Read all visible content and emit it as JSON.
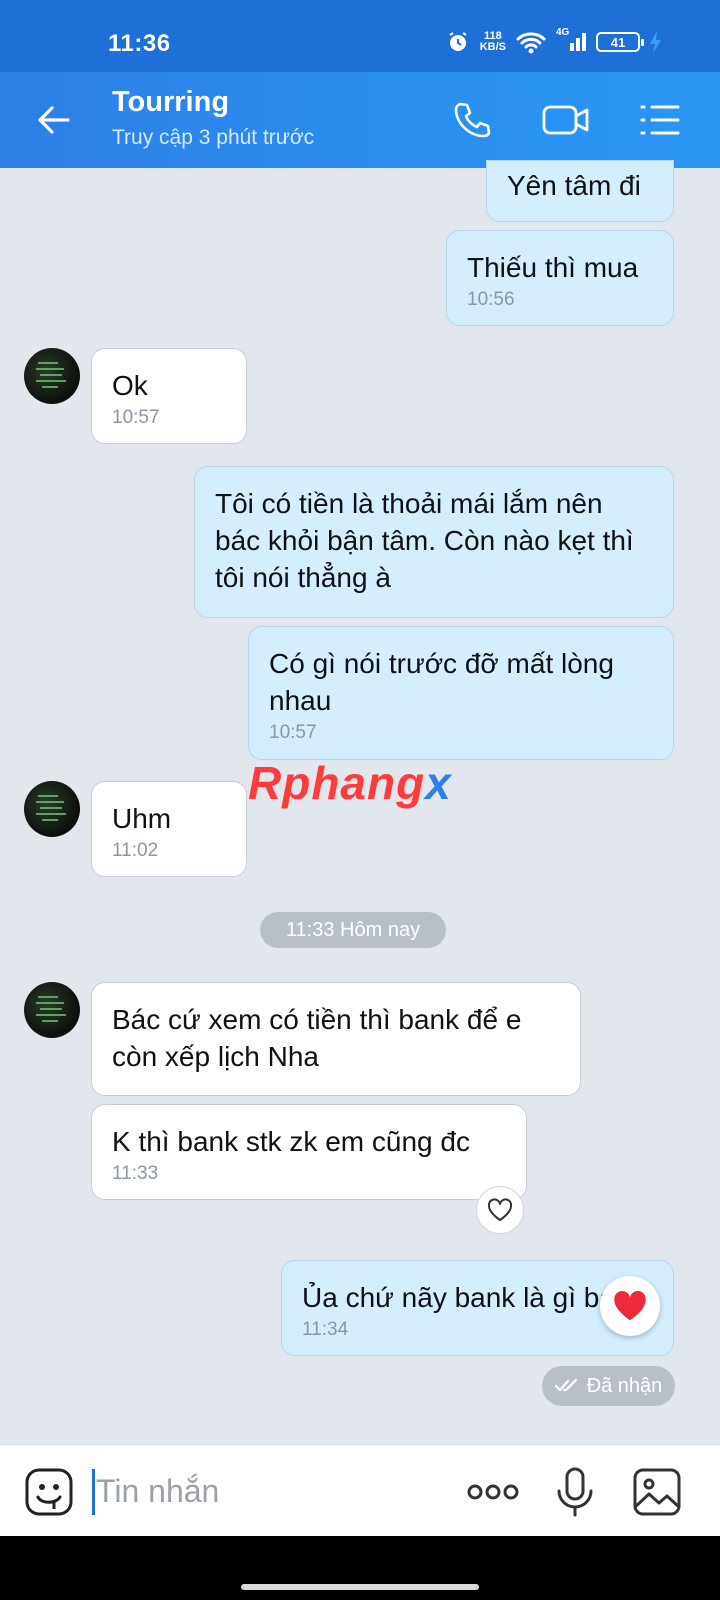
{
  "status": {
    "time": "11:36",
    "net_speed_value": "118",
    "net_speed_unit": "KB/S",
    "network": "4G",
    "battery": "41"
  },
  "header": {
    "title": "Tourring",
    "subtitle": "Truy cập 3 phút trước",
    "icons": [
      "back-arrow-icon",
      "phone-icon",
      "video-call-icon",
      "menu-list-icon"
    ]
  },
  "messages": [
    {
      "from": "me",
      "text": "Yên tâm đi"
    },
    {
      "from": "me",
      "text": "Thiếu thì mua",
      "time": "10:56"
    },
    {
      "from": "them",
      "text": "Ok",
      "time": "10:57"
    },
    {
      "from": "me",
      "text": "Tôi có tiền là thoải mái lắm nên bác khỏi bận tâm. Còn nào kẹt thì tôi nói thẳng à"
    },
    {
      "from": "me",
      "text": "Có gì nói trước đỡ mất lòng nhau",
      "time": "10:57"
    },
    {
      "from": "them",
      "text": "Uhm",
      "time": "11:02"
    },
    {
      "from": "them",
      "text": "Bác cứ xem có tiền thì bank để e còn xếp lịch Nha"
    },
    {
      "from": "them",
      "text": "K thì bank stk zk em cũng đc",
      "time": "11:33",
      "reaction": "heart-outline-icon"
    },
    {
      "from": "me",
      "text": "Ủa chứ nãy bank là gì bác",
      "time": "11:34",
      "reaction": "red-heart-icon"
    }
  ],
  "date_separator": "11:33 Hôm nay",
  "delivery_status": "Đã nhận",
  "watermark": {
    "part1": "Rphang",
    "part2": "x"
  },
  "input": {
    "placeholder": "Tin nhắn"
  },
  "colors": {
    "header": "#2f86ec",
    "outgoing_bubble": "#d5eefe",
    "incoming_bubble": "#ffffff",
    "background": "#e2e7ee"
  }
}
